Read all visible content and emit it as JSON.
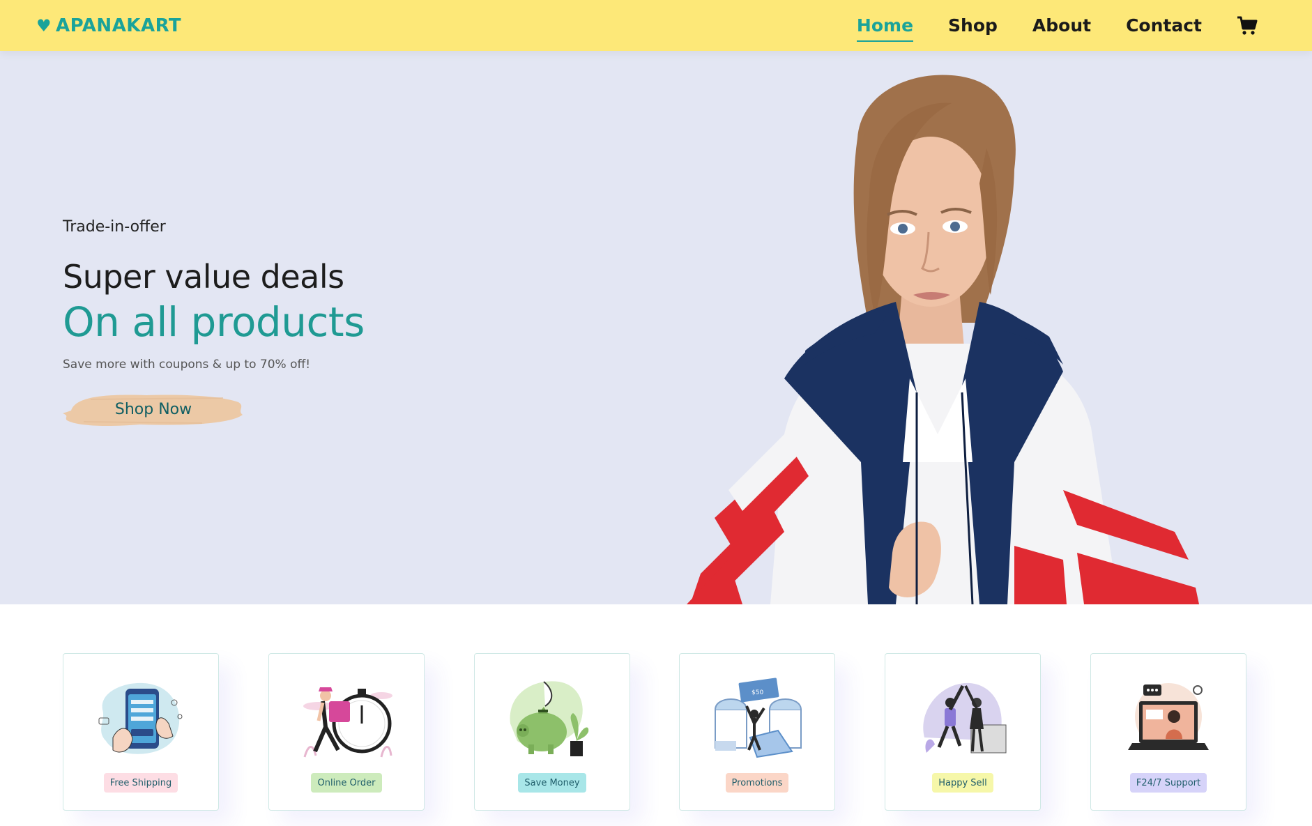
{
  "header": {
    "brand": "APANAKART",
    "nav": [
      {
        "label": "Home",
        "active": true
      },
      {
        "label": "Shop",
        "active": false
      },
      {
        "label": "About",
        "active": false
      },
      {
        "label": "Contact",
        "active": false
      }
    ],
    "cart_icon": "cart-icon"
  },
  "hero": {
    "offer_label": "Trade-in-offer",
    "headline_1": "Super value deals",
    "headline_2": "On all products",
    "subtext": "Save more with coupons & up to 70% off!",
    "cta_label": "Shop Now",
    "background": "#e3e6f3",
    "accent": "#1f9a93"
  },
  "features": [
    {
      "label": "Free Shipping",
      "badge_color": "#fddde4",
      "icon": "phone-payment-illustration"
    },
    {
      "label": "Online Order",
      "badge_color": "#cdebbc",
      "icon": "delivery-stopwatch-illustration"
    },
    {
      "label": "Save Money",
      "badge_color": "#d1e8f2",
      "icon": "piggy-bank-illustration"
    },
    {
      "label": "Promotions",
      "badge_color": "#fbd6c7",
      "icon": "promotion-illustration"
    },
    {
      "label": "Happy Sell",
      "badge_color": "#f6f7a9",
      "icon": "high-five-illustration"
    },
    {
      "label": "F24/7 Support",
      "badge_color": "#d6d3f9",
      "icon": "support-laptop-illustration"
    }
  ],
  "colors": {
    "header_bg": "#fde878",
    "brand": "#1aa39a"
  }
}
